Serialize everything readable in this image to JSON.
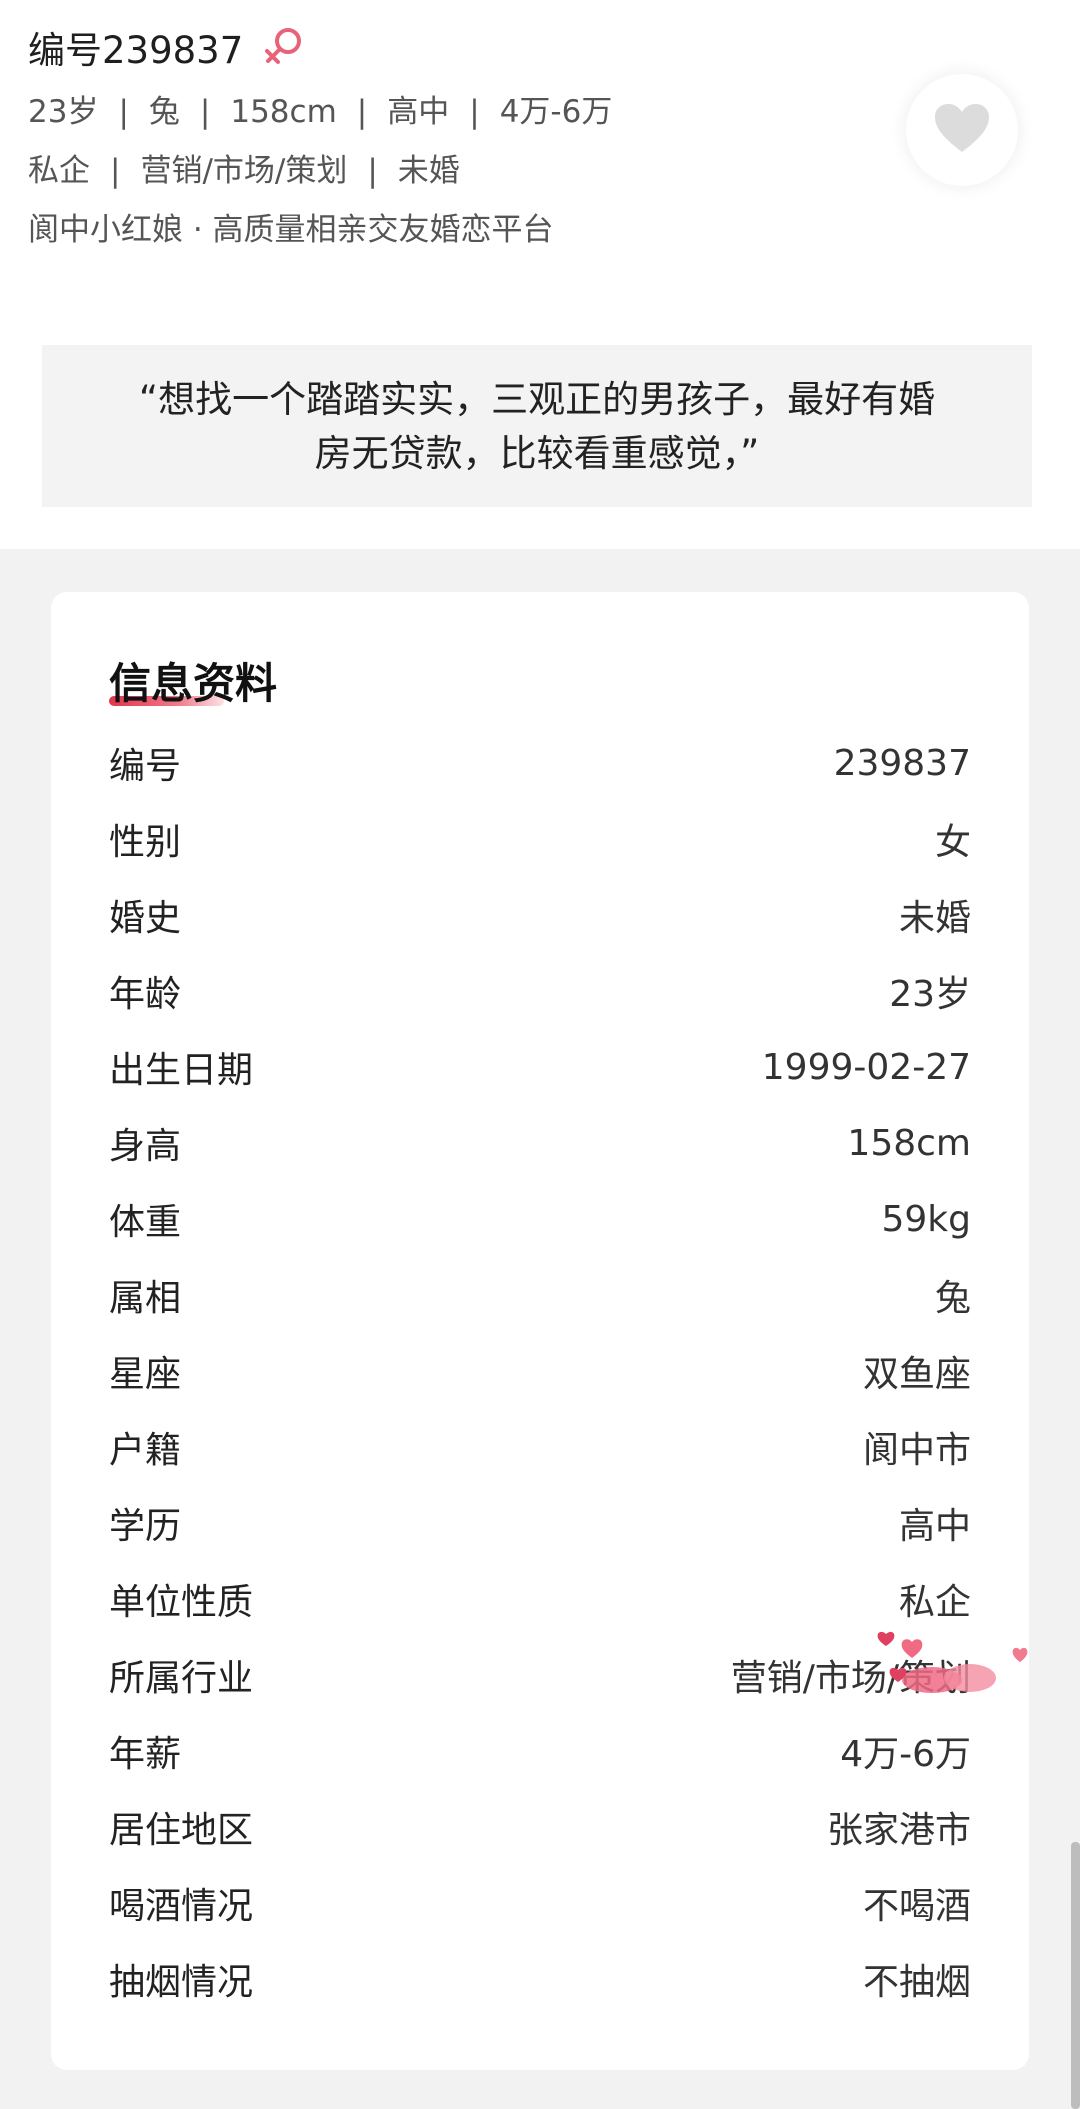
{
  "profile": {
    "id_line": "编号239837",
    "meta_line1": [
      "23岁",
      "兔",
      "158cm",
      "高中",
      "4万-6万"
    ],
    "meta_line2": [
      "私企",
      "营销/市场/策划",
      "未婚"
    ],
    "platform_line": "阆中小红娘 · 高质量相亲交友婚恋平台",
    "quote_line1": "“想找一个踏踏实实，三观正的男孩子，最好有婚",
    "quote_line2": "房无贷款，比较看重感觉，”"
  },
  "info_card": {
    "title": "信息资料",
    "rows": [
      {
        "label": "编号",
        "value": "239837"
      },
      {
        "label": "性别",
        "value": "女"
      },
      {
        "label": "婚史",
        "value": "未婚"
      },
      {
        "label": "年龄",
        "value": "23岁"
      },
      {
        "label": "出生日期",
        "value": "1999-02-27"
      },
      {
        "label": "身高",
        "value": "158cm"
      },
      {
        "label": "体重",
        "value": "59kg"
      },
      {
        "label": "属相",
        "value": "兔"
      },
      {
        "label": "星座",
        "value": "双鱼座"
      },
      {
        "label": "户籍",
        "value": "阆中市"
      },
      {
        "label": "学历",
        "value": "高中"
      },
      {
        "label": "单位性质",
        "value": "私企"
      },
      {
        "label": "所属行业",
        "value": "营销/市场/策划"
      },
      {
        "label": "年薪",
        "value": "4万-6万"
      },
      {
        "label": "居住地区",
        "value": "张家港市"
      },
      {
        "label": "喝酒情况",
        "value": "不喝酒"
      },
      {
        "label": "抽烟情况",
        "value": "不抽烟"
      }
    ]
  },
  "icons": {
    "gender": "female-icon",
    "like": "heart-icon",
    "decoration": "hearts-decoration"
  },
  "colors": {
    "accent": "#e3344a",
    "female_icon": "#e8637a",
    "heart_button": "#dcdcdc"
  }
}
